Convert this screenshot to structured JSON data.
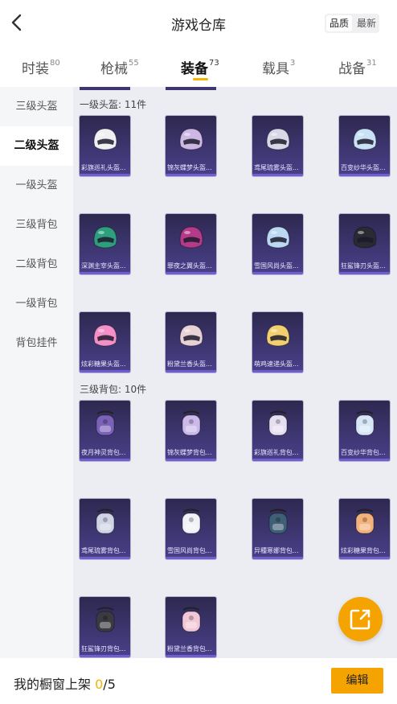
{
  "header": {
    "title": "游戏仓库",
    "sort": [
      "品质",
      "最新"
    ]
  },
  "tabs": [
    {
      "label": "时装",
      "count": "80"
    },
    {
      "label": "枪械",
      "count": "55"
    },
    {
      "label": "装备",
      "count": "73"
    },
    {
      "label": "载具",
      "count": "3"
    },
    {
      "label": "战备",
      "count": "31"
    }
  ],
  "sidebar": [
    "三级头盔",
    "二级头盔",
    "一级头盔",
    "三级背包",
    "二级背包",
    "一级背包",
    "背包挂件"
  ],
  "sections": [
    {
      "label": "一级头盔: 11件",
      "items": [
        {
          "name": "彩旗巡礼头盔...",
          "icon": "helmet-icon",
          "color": "#f0f0f2"
        },
        {
          "name": "锦灰蝶梦头盔...",
          "icon": "helmet-icon",
          "color": "#cdb8e4"
        },
        {
          "name": "鸢尾琉雾头盔...",
          "icon": "helmet-icon",
          "color": "#d8d8e8"
        },
        {
          "name": "百变纱华头盔...",
          "icon": "helmet-icon",
          "color": "#c9e2f5"
        },
        {
          "name": "深渊主宰头盔...",
          "icon": "helmet-icon",
          "color": "#2f9e7e"
        },
        {
          "name": "罪夜之翼头盔...",
          "icon": "helmet-icon",
          "color": "#b43a8a"
        },
        {
          "name": "雪国风尚头盔...",
          "icon": "helmet-icon",
          "color": "#bcd8f2"
        },
        {
          "name": "狂鲨锋刃头盔...",
          "icon": "helmet-icon",
          "color": "#2a2a32"
        },
        {
          "name": "炫彩糖果头盔...",
          "icon": "helmet-icon",
          "color": "#f48fc7"
        },
        {
          "name": "粉黛兰香头盔...",
          "icon": "helmet-icon",
          "color": "#e8d2d6"
        },
        {
          "name": "萌鸡速递头盔...",
          "icon": "helmet-icon",
          "color": "#f2d070"
        }
      ]
    },
    {
      "label": "三级背包: 10件",
      "items": [
        {
          "name": "夜月神灵背包...",
          "icon": "backpack-icon",
          "color": "#7a62b8"
        },
        {
          "name": "锦灰蝶梦背包...",
          "icon": "backpack-icon",
          "color": "#cbb9ea"
        },
        {
          "name": "彩旗巡礼背包...",
          "icon": "backpack-icon",
          "color": "#e6dff0"
        },
        {
          "name": "百变纱华背包...",
          "icon": "backpack-icon",
          "color": "#d6e6f6"
        },
        {
          "name": "鸢尾琉雾背包...",
          "icon": "backpack-icon",
          "color": "#cfd4e4"
        },
        {
          "name": "雪国风尚背包...",
          "icon": "backpack-icon",
          "color": "#f0f2f8"
        },
        {
          "name": "异種寒娜背包...",
          "icon": "backpack-icon",
          "color": "#3f5f76"
        },
        {
          "name": "炫彩糖果背包...",
          "icon": "backpack-icon",
          "color": "#f2b27a"
        },
        {
          "name": "狂鲨锋刃背包...",
          "icon": "backpack-icon",
          "color": "#3a3a40"
        },
        {
          "name": "粉黛兰香背包...",
          "icon": "backpack-icon",
          "color": "#f2c8d6"
        }
      ]
    }
  ],
  "footer": {
    "label": "我的橱窗上架",
    "shelved": "0",
    "total": "/5",
    "edit_label": "编辑"
  },
  "colors": {
    "accent": "#f5a300",
    "card_bg": "#3d3670"
  }
}
